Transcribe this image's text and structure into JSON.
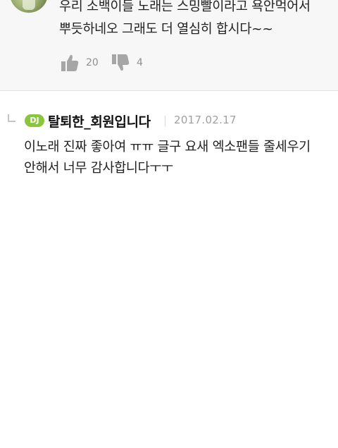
{
  "top_comment": {
    "text": "우리 소백이들 노래는 스밍빨이라고 욕안먹어서\n뿌듯하네오 그래도 더 열심히 합시다~~",
    "upvotes": "20",
    "downvotes": "4"
  },
  "reply_comment": {
    "badge": "DJ",
    "username": "탈퇴한_회원입니다",
    "date": "2017.02.17",
    "text": "이노래 진짜 좋아여 ㅠㅠ 글구 요새 엑소팬들 줄세우기\n안해서 너무 감사합니다ㅜㅜ"
  },
  "colors": {
    "badge_green": "#8cc43d",
    "grey_bg": "#f7f7f7",
    "icon_grey": "#8f8f8f"
  },
  "icons": {
    "upvote": "thumbs-up-icon",
    "downvote": "thumbs-down-icon",
    "reply": "reply-arrow-icon"
  }
}
